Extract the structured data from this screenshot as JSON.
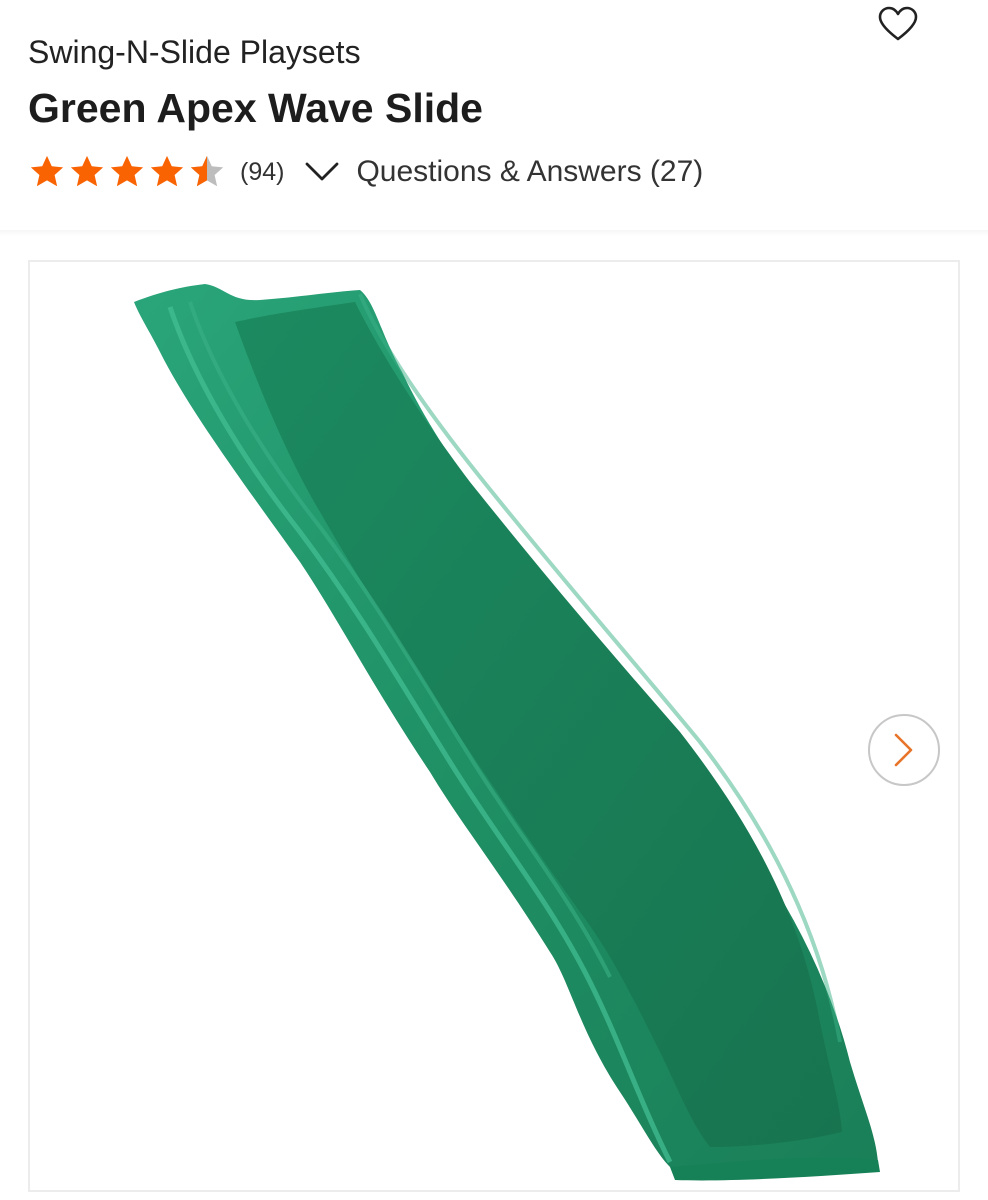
{
  "product": {
    "brand": "Swing-N-Slide Playsets",
    "title": "Green Apex Wave Slide",
    "rating": 4.5,
    "review_count_label": "(94)",
    "qa_label": "Questions & Answers (27)"
  },
  "icons": {
    "favorite": "heart-outline-icon",
    "expand": "chevron-down-icon",
    "next": "chevron-right-icon"
  },
  "colors": {
    "star": "#f96302",
    "star_empty": "#bdbdbd",
    "slide": "#1f8f64",
    "next_arrow": "#e8742a"
  }
}
